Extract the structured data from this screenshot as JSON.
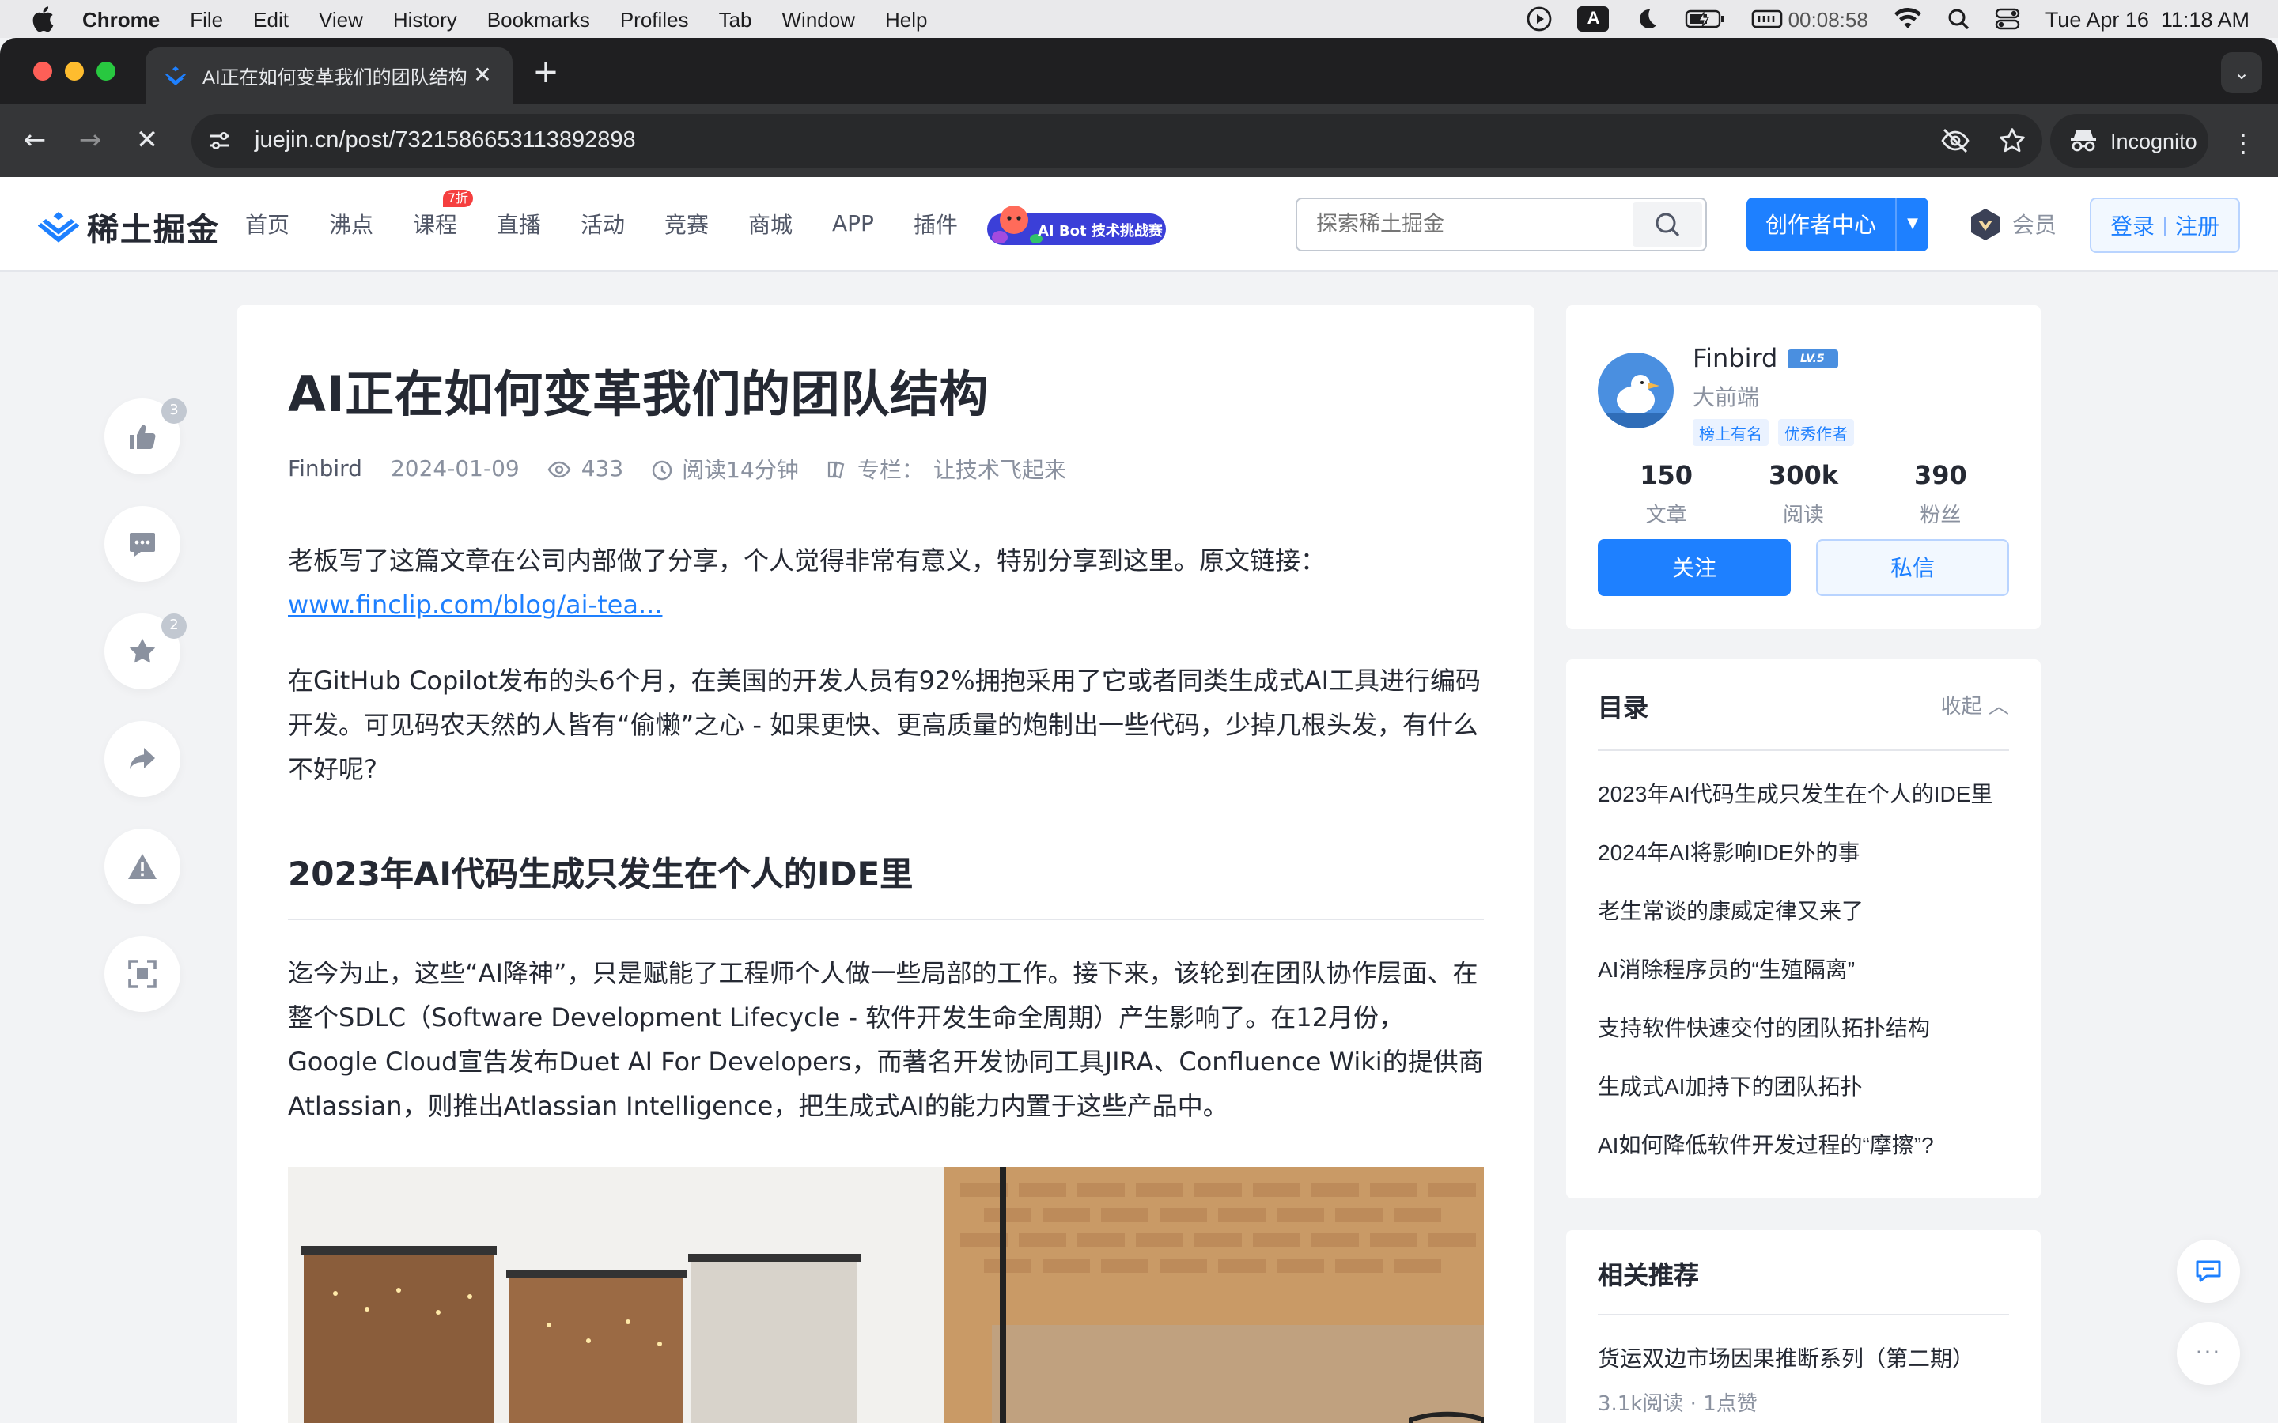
{
  "menubar": {
    "app": "Chrome",
    "items": [
      "File",
      "Edit",
      "View",
      "History",
      "Bookmarks",
      "Profiles",
      "Tab",
      "Window",
      "Help"
    ],
    "timer": "00:08:58",
    "datetime": "Tue Apr 16  11:18 AM",
    "input_badge": "A"
  },
  "browser": {
    "tab_title": "AI正在如何变革我们的团队结构",
    "url": "juejin.cn/post/7321586653113892898",
    "incognito_label": "Incognito"
  },
  "site": {
    "logo_text": "稀土掘金",
    "nav": [
      "首页",
      "沸点",
      "课程",
      "直播",
      "活动",
      "竞赛",
      "商城",
      "APP",
      "插件"
    ],
    "course_badge": "7折",
    "ai_bot_label": "AI Bot 技术挑战赛",
    "search_placeholder": "探索稀土掘金",
    "creator_label": "创作者中心",
    "vip_label": "会员",
    "login_label": "登录",
    "register_label": "注册"
  },
  "actions": {
    "like_count": "3",
    "star_count": "2"
  },
  "article": {
    "title": "AI正在如何变革我们的团队结构",
    "author": "Finbird",
    "date": "2024-01-09",
    "views": "433",
    "read_time": "阅读14分钟",
    "column_prefix": "专栏：",
    "column_name": "让技术飞起来",
    "p1": "老板写了这篇文章在公司内部做了分享，个人觉得非常有意义，特别分享到这里。原文链接：",
    "p1_link": "www.finclip.com/blog/ai-tea...",
    "p2": "在GitHub Copilot发布的头6个月，在美国的开发人员有92%拥抱采用了它或者同类生成式AI工具进行编码开发。可见码农天然的人皆有“偷懒”之心 - 如果更快、更高质量的炮制出一些代码，少掉几根头发，有什么不好呢?",
    "h2": "2023年AI代码生成只发生在个人的IDE里",
    "p3": "迄今为止，这些“AI降神”，只是赋能了工程师个人做一些局部的工作。接下来，该轮到在团队协作层面、在整个SDLC（Software Development Lifecycle - 软件开发生命全周期）产生影响了。在12月份，Google Cloud宣告发布Duet AI For Developers，而著名开发协同工具JIRA、Confluence Wiki的提供商Atlassian，则推出Atlassian Intelligence，把生成式AI的能力内置于这些产品中。"
  },
  "author_card": {
    "name": "Finbird",
    "level": "LV.5",
    "role": "大前端",
    "tag1": "榜上有名",
    "tag2": "优秀作者",
    "stats": [
      {
        "value": "150",
        "label": "文章"
      },
      {
        "value": "300k",
        "label": "阅读"
      },
      {
        "value": "390",
        "label": "粉丝"
      }
    ],
    "follow_label": "关注",
    "message_label": "私信"
  },
  "toc": {
    "title": "目录",
    "collapse_label": "收起",
    "items": [
      "2023年AI代码生成只发生在个人的IDE里",
      "2024年AI将影响IDE外的事",
      "老生常谈的康威定律又来了",
      "AI消除程序员的“生殖隔离”",
      "支持软件快速交付的团队拓扑结构",
      "生成式AI加持下的团队拓扑",
      "AI如何降低软件开发过程的“摩擦”?"
    ]
  },
  "related": {
    "title": "相关推荐",
    "item_title": "货运双边市场因果推断系列（第二期）",
    "item_meta": "3.1k阅读 · 1点赞"
  },
  "colors": {
    "brand": "#1e80ff",
    "page_bg": "#f2f3f5"
  }
}
